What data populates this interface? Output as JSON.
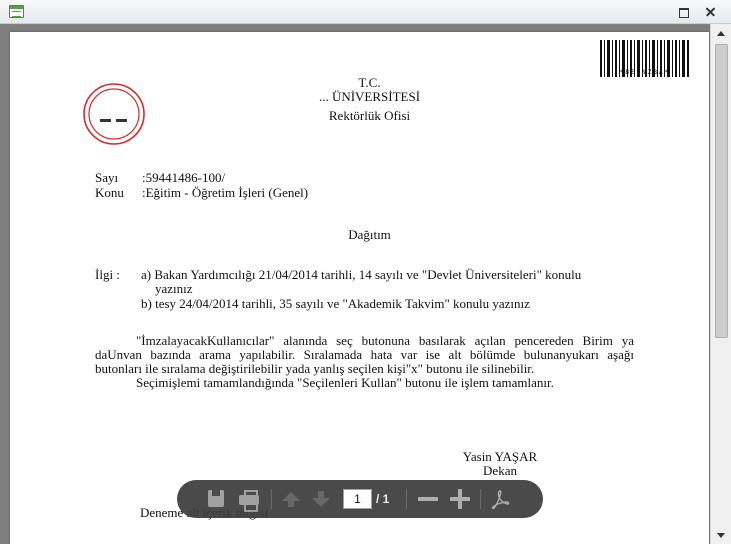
{
  "window": {
    "title": "",
    "icon": "document-viewer-icon",
    "buttons": [
      "maximize-icon",
      "close-icon"
    ]
  },
  "document": {
    "header": {
      "line1": "T.C.",
      "line2": "... ÜNİVERSİTESİ",
      "line3": "Rektörlük Ofisi"
    },
    "barcode_text": "*BEONZBA*",
    "meta": {
      "sayi_label": "Sayı",
      "sayi_value": ":59441486-100/",
      "konu_label": "Konu",
      "konu_value": ":Eğitim - Öğretim İşleri (Genel)"
    },
    "distribution": "Dağıtım",
    "ilgi": {
      "label": "İlgi :",
      "item_a_line1": "a) Bakan Yardımcılığı 21/04/2014 tarihli, 14 sayılı ve \"Devlet Üniversiteleri\" konulu",
      "item_a_line2": "yazınız",
      "item_b": "b) tesy 24/04/2014 tarihli, 35 sayılı ve \"Akademik Takvim\" konulu yazınız"
    },
    "body_lines": [
      "\"İmzalayacakKullanıcılar\" alanında seç butonuna basılarak açılan pencereden Birim ya",
      "daUnvan bazında arama yapılabilir. Sıralamada hata var ise alt bölümde bulunanyukarı aşağı",
      "butonları ile sıralama değiştirilebilir yada yanlış seçilen kişi\"x\" butonu ile silinebilir.",
      "Seçimişlemi tamamlandığında \"Seçilenleri Kullan\" butonu ile işlem tamamlanır."
    ],
    "signature": {
      "name": "Yasin YAŞAR",
      "title": "Dekan"
    },
    "footer_text": "Deneme alt içerik bilgisi"
  },
  "toolbar": {
    "current_page": "1",
    "total_pages": "/ 1",
    "icons": [
      "save-icon",
      "print-icon",
      "page-up-icon",
      "page-down-icon",
      "zoom-out-icon",
      "zoom-in-icon",
      "acrobat-icon"
    ]
  },
  "colors": {
    "viewer_background": "#7e7e7e",
    "toolbar_background": "#3d3d3d",
    "seal_red": "#d42a2a"
  }
}
